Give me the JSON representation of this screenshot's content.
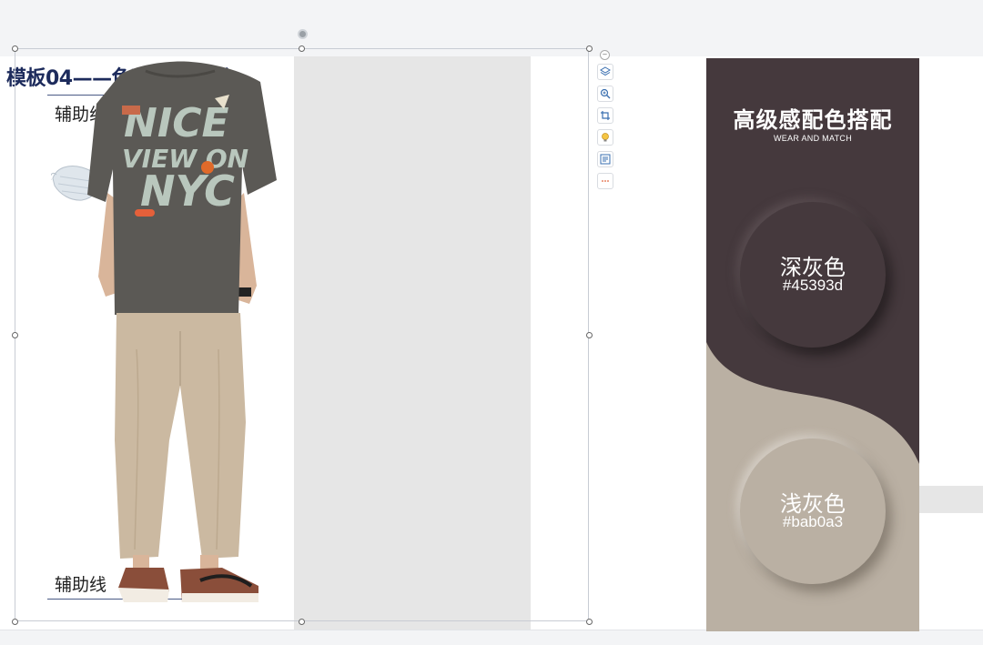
{
  "slide": {
    "title": "模板04——色彩搭配模板",
    "guide_top_label": "辅助线",
    "guide_bottom_label": "辅助线"
  },
  "tshirt": {
    "print_line1": "NICE",
    "print_line2": "VIEW ON",
    "print_line3": "NYC"
  },
  "card": {
    "title": "高级感配色搭配",
    "subtitle": "WEAR AND MATCH",
    "colors": [
      {
        "name": "深灰色",
        "hex": "#45393d"
      },
      {
        "name": "浅灰色",
        "hex": "#bab0a3"
      }
    ]
  },
  "toolbar": {
    "icons": [
      "layers-icon",
      "zoom-icon",
      "crop-icon",
      "bulb-icon",
      "image-text-icon",
      "more-icon"
    ]
  },
  "theme": {
    "title_color": "#1d2b5c",
    "dark_gray": "#45393d",
    "light_gray": "#bab0a3"
  }
}
